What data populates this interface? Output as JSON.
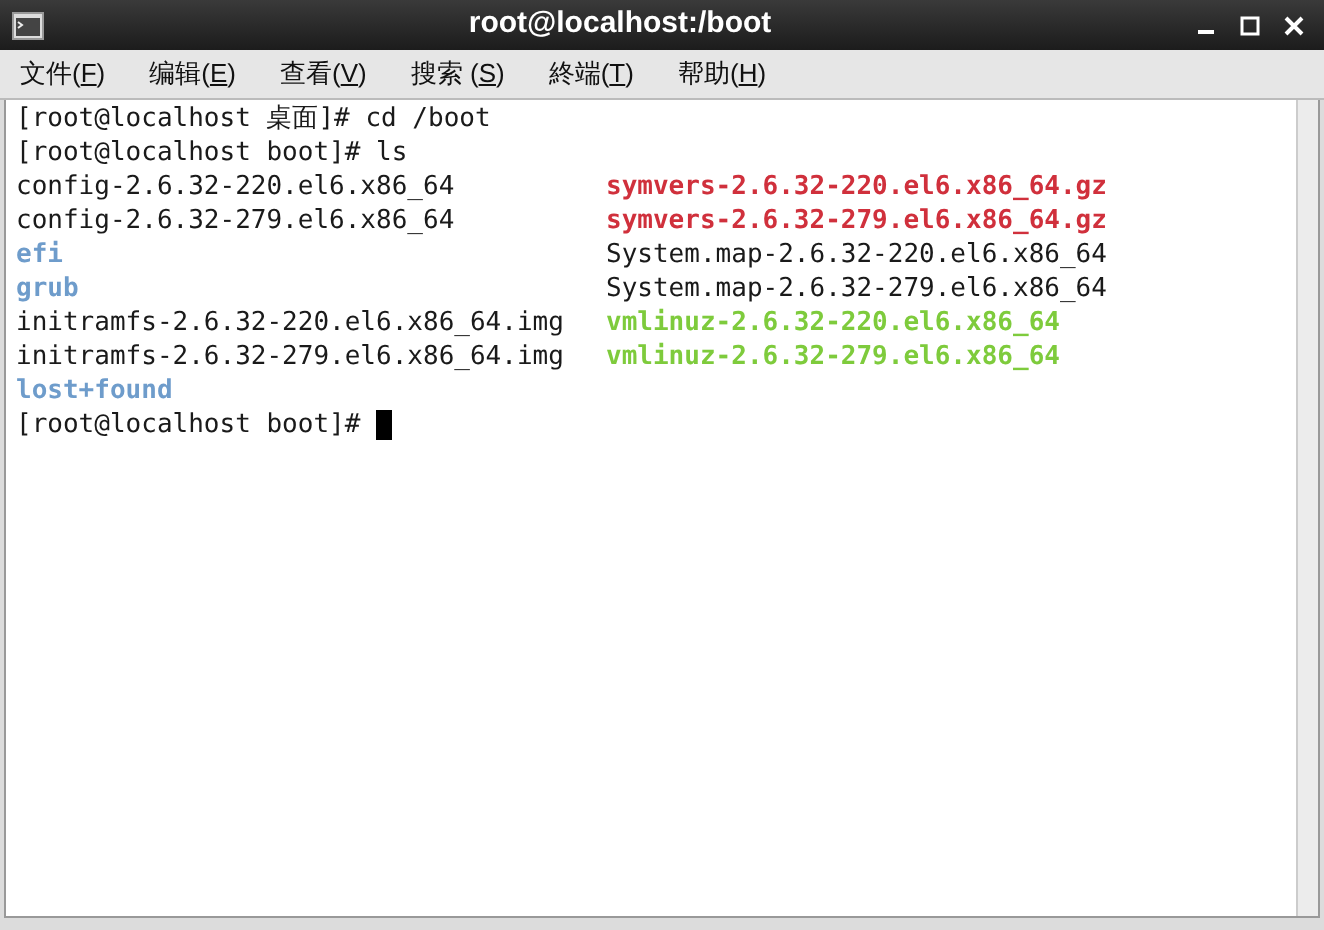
{
  "window": {
    "title": "root@localhost:/boot"
  },
  "menu": [
    {
      "before": "文件(",
      "key": "F",
      "after": ")"
    },
    {
      "before": "编辑(",
      "key": "E",
      "after": ")"
    },
    {
      "before": "查看(",
      "key": "V",
      "after": ")"
    },
    {
      "before": "搜索 (",
      "key": "S",
      "after": ")"
    },
    {
      "before": "終端(",
      "key": "T",
      "after": ")"
    },
    {
      "before": "帮助(",
      "key": "H",
      "after": ")"
    }
  ],
  "terminal": {
    "commands": [
      "[root@localhost 桌面]# cd /boot",
      "[root@localhost boot]# ls"
    ],
    "listing": [
      [
        {
          "name": "config-2.6.32-220.el6.x86_64",
          "kind": "file"
        },
        {
          "name": "symvers-2.6.32-220.el6.x86_64.gz",
          "kind": "archive"
        }
      ],
      [
        {
          "name": "config-2.6.32-279.el6.x86_64",
          "kind": "file"
        },
        {
          "name": "symvers-2.6.32-279.el6.x86_64.gz",
          "kind": "archive"
        }
      ],
      [
        {
          "name": "efi",
          "kind": "dir"
        },
        {
          "name": "System.map-2.6.32-220.el6.x86_64",
          "kind": "file"
        }
      ],
      [
        {
          "name": "grub",
          "kind": "dir"
        },
        {
          "name": "System.map-2.6.32-279.el6.x86_64",
          "kind": "file"
        }
      ],
      [
        {
          "name": "initramfs-2.6.32-220.el6.x86_64.img",
          "kind": "file"
        },
        {
          "name": "vmlinuz-2.6.32-220.el6.x86_64",
          "kind": "exec"
        }
      ],
      [
        {
          "name": "initramfs-2.6.32-279.el6.x86_64.img",
          "kind": "file"
        },
        {
          "name": "vmlinuz-2.6.32-279.el6.x86_64",
          "kind": "exec"
        }
      ],
      [
        {
          "name": "lost+found",
          "kind": "dir"
        }
      ]
    ],
    "prompt": "[root@localhost boot]#"
  }
}
